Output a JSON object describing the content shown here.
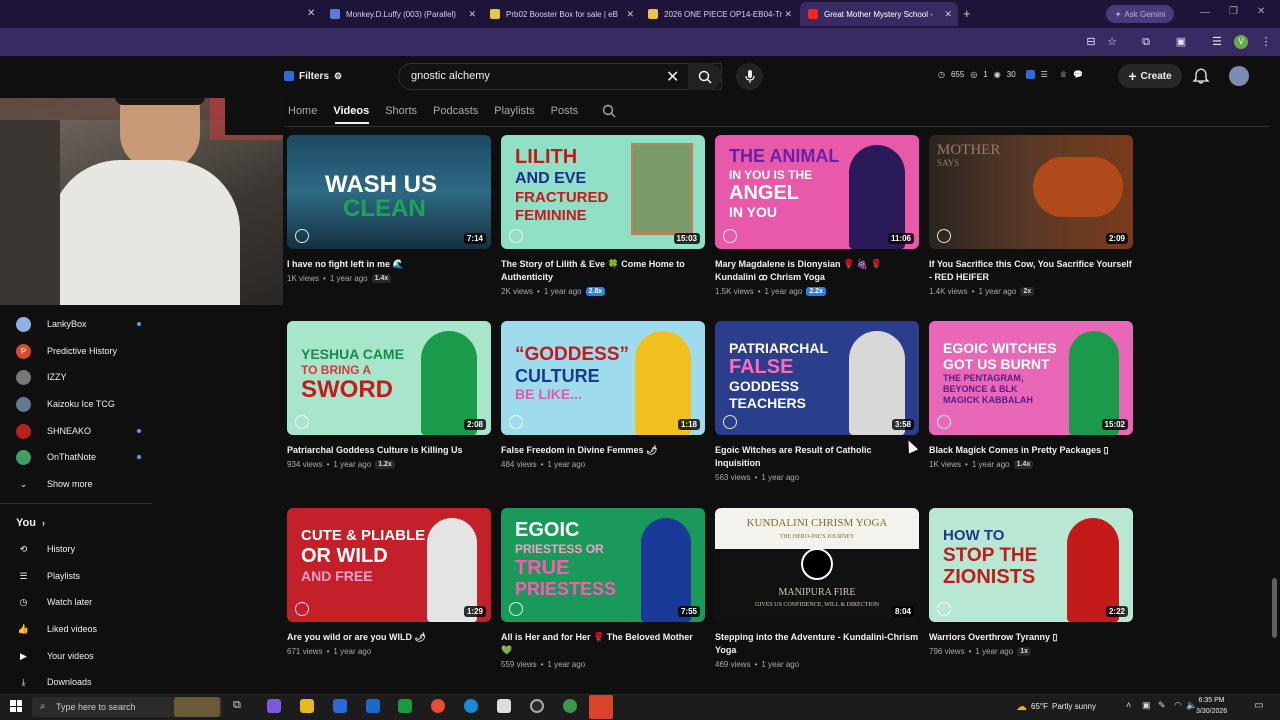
{
  "browser": {
    "tabs": [
      {
        "label": "Monkey.D.Luffy (003) (Parallel)",
        "color": "#5a7bd8"
      },
      {
        "label": "Prb02 Booster Box for sale | eB",
        "color": "#e8c547"
      },
      {
        "label": "2026 ONE PIECE OP14-EB04-Tr",
        "color": "#e8c547"
      },
      {
        "label": "Great Mother Mystery School -",
        "color": "#ff2020"
      }
    ],
    "ask_label": "Ask Gemini"
  },
  "header": {
    "filters_label": "Filters",
    "search_value": "gnostic alchemy",
    "stats": [
      "655",
      "1",
      "30"
    ],
    "create_label": "Create"
  },
  "channel_tabs": [
    "Home",
    "Videos",
    "Shorts",
    "Podcasts",
    "Playlists",
    "Posts"
  ],
  "sidebar": {
    "subscriptions": [
      {
        "name": "LankyBox",
        "dot": true
      },
      {
        "name": "Predictive History",
        "dot": false
      },
      {
        "name": "IZZY",
        "dot": false
      },
      {
        "name": "Kaizoku Ice TCG",
        "dot": false
      },
      {
        "name": "SHNEAKO",
        "dot": true
      },
      {
        "name": "OnThatNote",
        "dot": true
      }
    ],
    "show_more": "Show more",
    "you_label": "You",
    "you_items": [
      "History",
      "Playlists",
      "Watch later",
      "Liked videos",
      "Your videos",
      "Downloads"
    ]
  },
  "videos": [
    {
      "title": "I have no fight left in me 🌊",
      "views": "1K views",
      "age": "1 year ago",
      "speed": "1.4x",
      "speed_blue": false,
      "duration": "7:14",
      "thumb_text": [
        "WASH US",
        "CLEAN"
      ]
    },
    {
      "title": "The Story of Lilith & Eve 🍀 Come Home to Authenticity",
      "views": "2K views",
      "age": "1 year ago",
      "speed": "2.8x",
      "speed_blue": true,
      "duration": "15:03",
      "thumb_text": [
        "LILITH",
        "AND EVE",
        "FRACTURED",
        "FEMININE"
      ]
    },
    {
      "title": "Mary Magdalene is Dionysian 🌹 🍇 🌹 Kundalini ꝏ Chrism Yoga",
      "views": "1.5K views",
      "age": "1 year ago",
      "speed": "2.2x",
      "speed_blue": true,
      "duration": "11:06",
      "thumb_text": [
        "THE ANIMAL",
        "IN YOU IS THE",
        "ANGEL",
        "IN YOU"
      ]
    },
    {
      "title": "If You Sacrifice this Cow, You Sacrifice Yourself - RED HEIFER",
      "views": "1.4K views",
      "age": "1 year ago",
      "speed": "2x",
      "speed_blue": false,
      "duration": "2:09",
      "thumb_text": [
        "MOTHER",
        "SAYS"
      ]
    },
    {
      "title": "Patriarchal Goddess Culture is Killing Us",
      "views": "934 views",
      "age": "1 year ago",
      "speed": "1.2x",
      "speed_blue": false,
      "duration": "2:08",
      "thumb_text": [
        "YESHUA CAME",
        "TO BRING A",
        "SWORD"
      ]
    },
    {
      "title": "False Freedom in Divine Femmes 🌶",
      "views": "484 views",
      "age": "1 year ago",
      "speed": "",
      "speed_blue": false,
      "duration": "1:18",
      "thumb_text": [
        "“GODDESS”",
        "CULTURE",
        "BE LIKE..."
      ]
    },
    {
      "title": "Egoic Witches are Result of Catholic Inquisition",
      "views": "563 views",
      "age": "1 year ago",
      "speed": "",
      "speed_blue": false,
      "duration": "3:58",
      "thumb_text": [
        "PATRIARCHAL",
        "FALSE",
        "GODDESS",
        "TEACHERS"
      ]
    },
    {
      "title": "Black Magick Comes in Pretty Packages ▯",
      "views": "1K views",
      "age": "1 year ago",
      "speed": "1.4x",
      "speed_blue": false,
      "duration": "15:02",
      "thumb_text": [
        "EGOIC WITCHES",
        "GOT US BURNT",
        "THE PENTAGRAM,",
        "BEYONCE & BLK",
        "MAGICK KABBALAH"
      ]
    },
    {
      "title": "Are you wild or are you WILD 🌶",
      "views": "671 views",
      "age": "1 year ago",
      "speed": "",
      "speed_blue": false,
      "duration": "1:29",
      "thumb_text": [
        "CUTE & PLIABLE",
        "OR WILD",
        "AND FREE"
      ]
    },
    {
      "title": "All is Her and for Her 🌹 The Beloved Mother 💚",
      "views": "559 views",
      "age": "1 year ago",
      "speed": "",
      "speed_blue": false,
      "duration": "7:55",
      "thumb_text": [
        "EGOIC",
        "PRIESTESS OR",
        "TRUE",
        "PRIESTESS"
      ]
    },
    {
      "title": "Stepping into the Adventure - Kundalini-Chrism Yoga",
      "views": "469 views",
      "age": "1 year ago",
      "speed": "",
      "speed_blue": false,
      "duration": "8:04",
      "thumb_text": [
        "KUNDALINI CHRISM YOGA",
        "THE HERO-INE'S JOURNEY",
        "MANIPURA FIRE",
        "GIVES US CONFIDENCE, WILL & DIRECTION"
      ]
    },
    {
      "title": "Warriors Overthrow Tyranny ▯",
      "views": "796 views",
      "age": "1 year ago",
      "speed": "1x",
      "speed_blue": false,
      "duration": "2:22",
      "thumb_text": [
        "HOW TO",
        "STOP THE",
        "ZIONISTS"
      ]
    }
  ],
  "taskbar": {
    "search_placeholder": "Type here to search",
    "temperature": "65°F",
    "weather": "Partly sunny",
    "time": "6:35 PM",
    "date": "3/30/2026"
  },
  "colors": {
    "background": "#0f0f0f",
    "browser_tab_bg": "#1e1438",
    "browser_bar_bg": "#3a2a63",
    "accent_blue": "#3ea6ff"
  }
}
